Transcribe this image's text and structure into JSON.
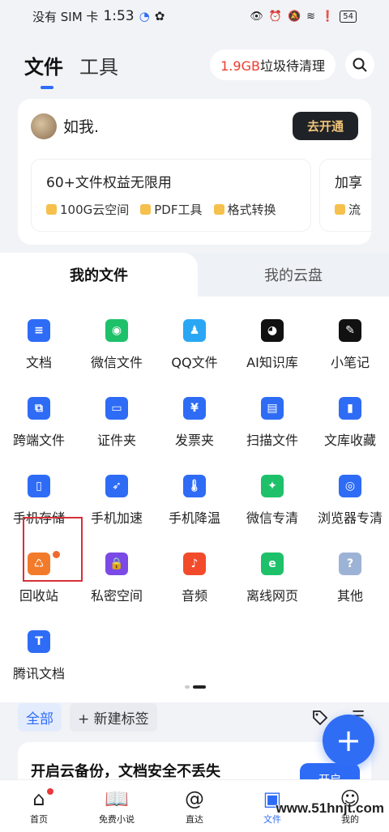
{
  "status": {
    "carrier": "没有 SIM 卡",
    "time": "1:53",
    "battery": "54"
  },
  "header": {
    "tab_files": "文件",
    "tab_tools": "工具",
    "junk_size": "1.9GB",
    "junk_text": "垃圾待清理"
  },
  "member": {
    "username": "如我.",
    "open_button": "去开通",
    "benefit_title": "60+文件权益无限用",
    "benefit_items": [
      "100G云空间",
      "PDF工具",
      "格式转换"
    ],
    "benefit2_title": "加享",
    "benefit2_item": "流"
  },
  "files_panel": {
    "tab_my_files": "我的文件",
    "tab_my_cloud": "我的云盘",
    "items": [
      {
        "label": "文档",
        "icon": "document-icon",
        "color": "#2e6cf6"
      },
      {
        "label": "微信文件",
        "icon": "wechat-icon",
        "color": "#1ec16a"
      },
      {
        "label": "QQ文件",
        "icon": "qq-icon",
        "color": "#2aa7f4"
      },
      {
        "label": "AI知识库",
        "icon": "panda-icon",
        "color": "#111111"
      },
      {
        "label": "小笔记",
        "icon": "note-icon",
        "color": "#111111"
      },
      {
        "label": "跨端文件",
        "icon": "cross-device-icon",
        "color": "#2e6cf6"
      },
      {
        "label": "证件夹",
        "icon": "id-folder-icon",
        "color": "#2e6cf6"
      },
      {
        "label": "发票夹",
        "icon": "invoice-icon",
        "color": "#2e6cf6"
      },
      {
        "label": "扫描文件",
        "icon": "scan-icon",
        "color": "#2e6cf6"
      },
      {
        "label": "文库收藏",
        "icon": "library-bookmark-icon",
        "color": "#2e6cf6"
      },
      {
        "label": "手机存储",
        "icon": "phone-storage-icon",
        "color": "#2e6cf6"
      },
      {
        "label": "手机加速",
        "icon": "rocket-icon",
        "color": "#2e6cf6"
      },
      {
        "label": "手机降温",
        "icon": "thermometer-icon",
        "color": "#2e6cf6"
      },
      {
        "label": "微信专清",
        "icon": "wechat-clean-icon",
        "color": "#1ec16a"
      },
      {
        "label": "浏览器专清",
        "icon": "browser-clean-icon",
        "color": "#2e6cf6"
      },
      {
        "label": "回收站",
        "icon": "recycle-icon",
        "color": "#f27b2b"
      },
      {
        "label": "私密空间",
        "icon": "private-lock-icon",
        "color": "#7b4ae6"
      },
      {
        "label": "音频",
        "icon": "music-icon",
        "color": "#f24b2b"
      },
      {
        "label": "离线网页",
        "icon": "offline-web-icon",
        "color": "#1ec16a"
      },
      {
        "label": "其他",
        "icon": "question-icon",
        "color": "#9db3d6"
      },
      {
        "label": "腾讯文档",
        "icon": "tencent-docs-icon",
        "color": "#2e6cf6"
      }
    ]
  },
  "tags": {
    "all": "全部",
    "new_tag": "+ 新建标签"
  },
  "backup": {
    "title": "开启云备份，文档安全不丢失",
    "button": "开启"
  },
  "bottom_nav": [
    {
      "label": "首页",
      "icon": "home-icon"
    },
    {
      "label": "免费小说",
      "icon": "book-icon"
    },
    {
      "label": "直达",
      "icon": "at-icon"
    },
    {
      "label": "文件",
      "icon": "folder-icon"
    },
    {
      "label": "我的",
      "icon": "profile-icon"
    }
  ],
  "watermark": "www.51hnjt.com"
}
